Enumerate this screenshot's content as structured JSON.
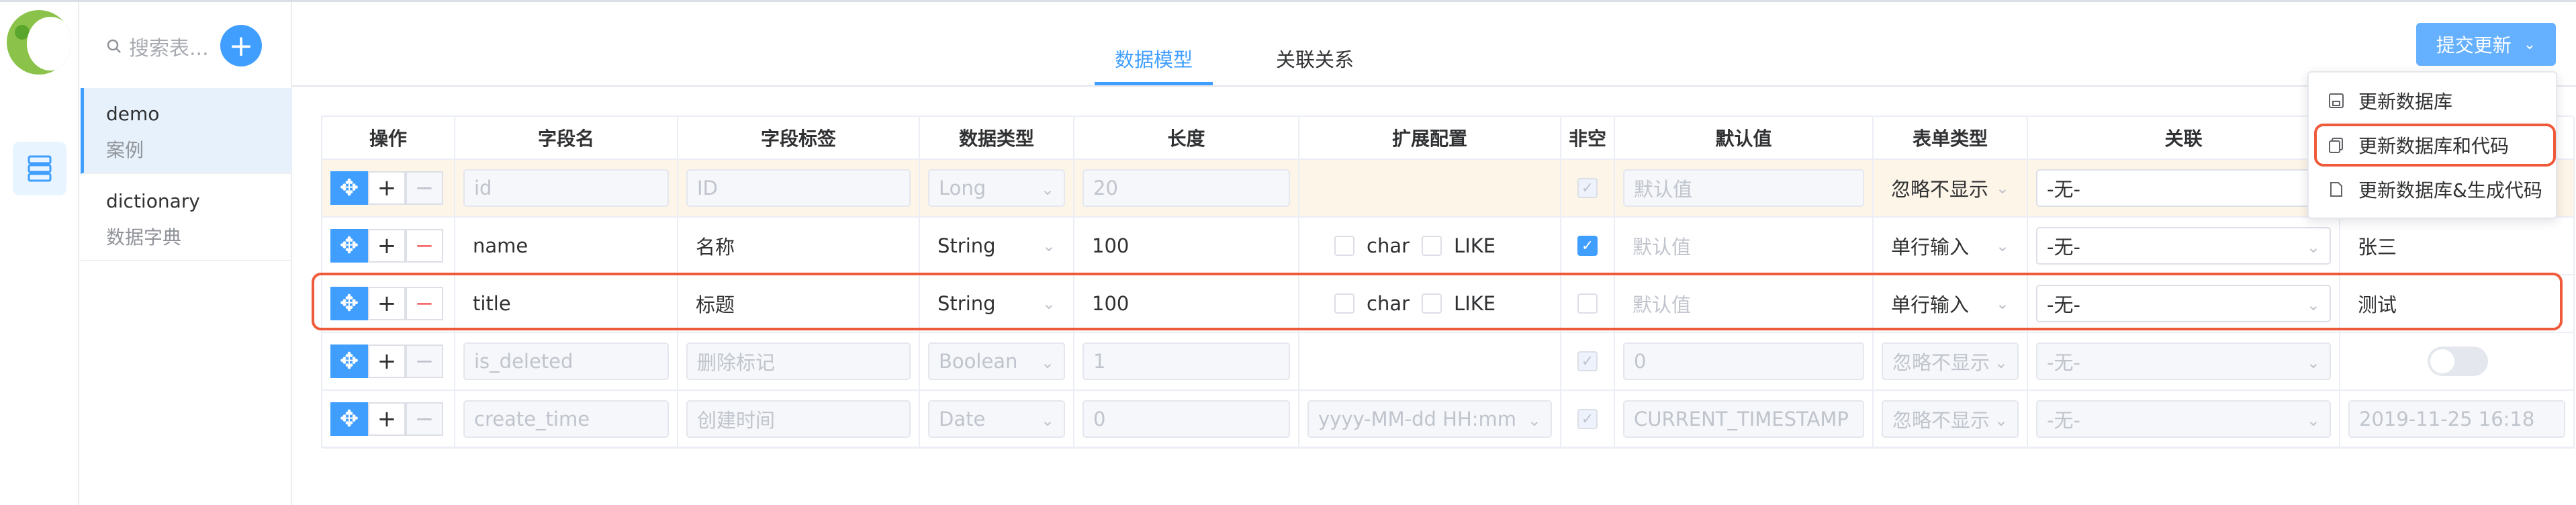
{
  "search": {
    "placeholder": "搜索表..."
  },
  "sidebar": {
    "items": [
      {
        "title": "demo",
        "subtitle": "案例"
      },
      {
        "title": "dictionary",
        "subtitle": "数据字典"
      }
    ]
  },
  "tabs": [
    {
      "label": "数据模型",
      "active": true
    },
    {
      "label": "关联关系",
      "active": false
    }
  ],
  "submit": {
    "label": "提交更新"
  },
  "dropdown": {
    "items": [
      {
        "label": "更新数据库"
      },
      {
        "label": "更新数据库和代码"
      },
      {
        "label": "更新数据库&生成代码"
      }
    ]
  },
  "table": {
    "headers": [
      "操作",
      "字段名",
      "字段标签",
      "数据类型",
      "长度",
      "扩展配置",
      "非空",
      "默认值",
      "表单类型",
      "关联",
      ""
    ],
    "ext_labels": {
      "char": "char",
      "like": "LIKE"
    },
    "rows": [
      {
        "field": "id",
        "label": "ID",
        "type": "Long",
        "length": "20",
        "ext": "",
        "notnull": "checked-disabled",
        "default": "默认值",
        "form": "忽略不显示",
        "relation": "-无-",
        "extra": ""
      },
      {
        "field": "name",
        "label": "名称",
        "type": "String",
        "length": "100",
        "ext": "char-like",
        "notnull": "checked",
        "default": "默认值",
        "form": "单行输入",
        "relation": "-无-",
        "extra": "张三"
      },
      {
        "field": "title",
        "label": "标题",
        "type": "String",
        "length": "100",
        "ext": "char-like",
        "notnull": "unchecked",
        "default": "默认值",
        "form": "单行输入",
        "relation": "-无-",
        "extra": "测试"
      },
      {
        "field": "is_deleted",
        "label": "删除标记",
        "type": "Boolean",
        "length": "1",
        "ext": "",
        "notnull": "checked-disabled",
        "default": "0",
        "form": "忽略不显示",
        "relation": "-无-",
        "extra": "toggle"
      },
      {
        "field": "create_time",
        "label": "创建时间",
        "type": "Date",
        "length": "0",
        "ext": "yyyy-MM-dd HH:mm",
        "notnull": "checked-disabled",
        "default": "CURRENT_TIMESTAMP",
        "form": "忽略不显示",
        "relation": "-无-",
        "extra": "2019-11-25 16:18"
      }
    ]
  },
  "colors": {
    "primary": "#409eff",
    "highlight_ring": "#ef5b3a",
    "row_highlight": "#fdf5e8"
  }
}
